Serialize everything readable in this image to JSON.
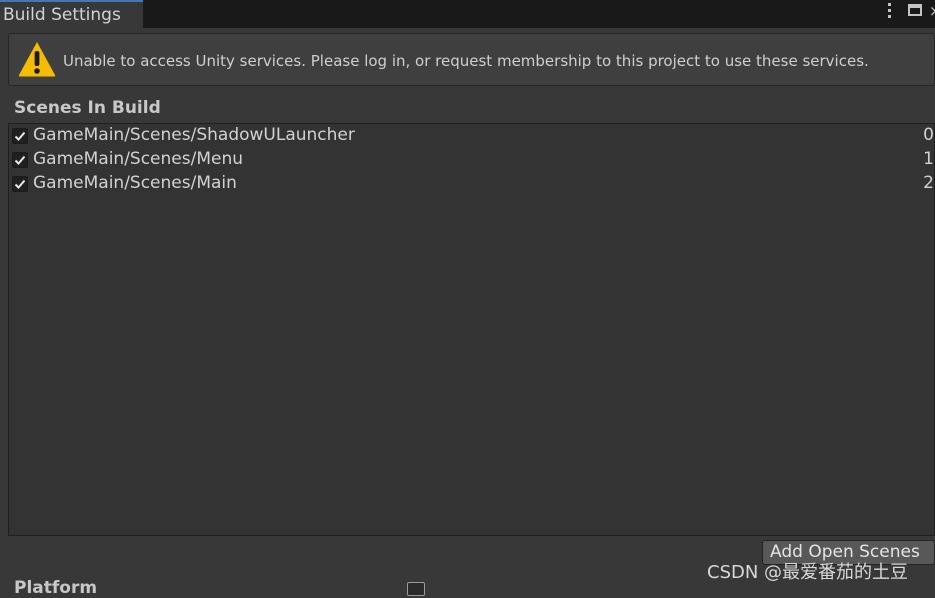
{
  "window": {
    "tab_title": "Build Settings",
    "tab_close_glyph": "×",
    "icons": [
      "more-vert-icon",
      "maximize-icon",
      "close-icon"
    ]
  },
  "help_box": {
    "icon": "warning-icon",
    "message": "Unable to access Unity services. Please log in, or request membership to this project to use these services.",
    "icon_color": "#f4bc02"
  },
  "scenes_section": {
    "title": "Scenes In Build",
    "scenes": [
      {
        "path": "GameMain/Scenes/ShadowULauncher",
        "index": "0",
        "checked": true
      },
      {
        "path": "GameMain/Scenes/Menu",
        "index": "1",
        "checked": true
      },
      {
        "path": "GameMain/Scenes/Main",
        "index": "2",
        "checked": true
      }
    ],
    "add_open_scenes_label": "Add Open Scenes"
  },
  "platform_section": {
    "title": "Platform"
  },
  "watermark": "CSDN @最爱番茄的土豆",
  "colors": {
    "background": "#383838",
    "tab_accent": "#3a79bb",
    "button": "#585858"
  }
}
